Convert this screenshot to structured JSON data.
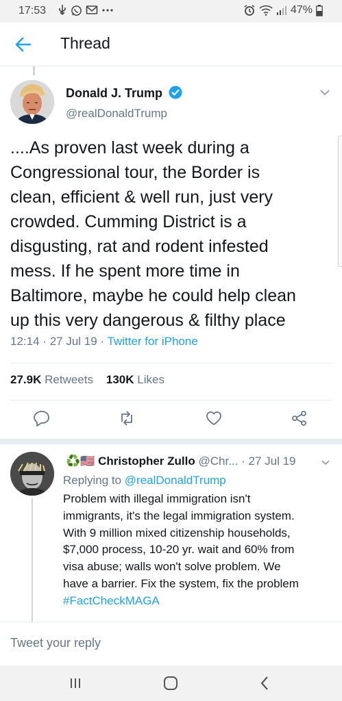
{
  "status_bar": {
    "time": "17:53",
    "left_icons": [
      "usb-icon",
      "whatsapp-icon",
      "message-icon",
      "more-icon"
    ],
    "right_icons": [
      "alarm-icon",
      "wifi-icon",
      "signal-icon"
    ],
    "battery": "47%"
  },
  "header": {
    "title": "Thread"
  },
  "main_tweet": {
    "author_name": "Donald J. Trump",
    "handle": "@realDonaldTrump",
    "text_lines": [
      "....As proven last week during a",
      "Congressional tour, the Border is",
      "clean, efficient & well run, just very",
      "crowded. Cumming District is a",
      "disgusting, rat and rodent infested",
      "mess. If he spent more time in",
      "Baltimore, maybe he could help clean",
      "up this very dangerous & filthy place"
    ],
    "time": "12:14",
    "dot": "·",
    "date": "27 Jul 19",
    "source": "Twitter for iPhone",
    "retweets_count": "27.9K",
    "retweets_label": "Retweets",
    "likes_count": "130K",
    "likes_label": "Likes"
  },
  "reply": {
    "emoji": "♻️🇺🇸",
    "author_name": "Christopher Zullo",
    "handle": "@Chr...",
    "dot": "·",
    "date": "27 Jul 19",
    "replying_to_label": "Replying to",
    "replying_to_handle": "@realDonaldTrump",
    "text_lines": [
      "Problem with illegal immigration isn't",
      "immigrants, it's the legal immigration system.",
      "With 9 million mixed citizenship households,",
      "$7,000 process, 10-20 yr. wait and 60% from",
      "visa abuse; walls won't solve problem. We",
      "have a barrier. Fix the system, fix the problem"
    ],
    "hashtag": "#FactCheckMAGA"
  },
  "composer": {
    "placeholder": "Tweet your reply"
  },
  "colors": {
    "accent": "#1da1f2",
    "muted": "#657786",
    "text": "#14171a",
    "divider": "#e6ecf0"
  }
}
